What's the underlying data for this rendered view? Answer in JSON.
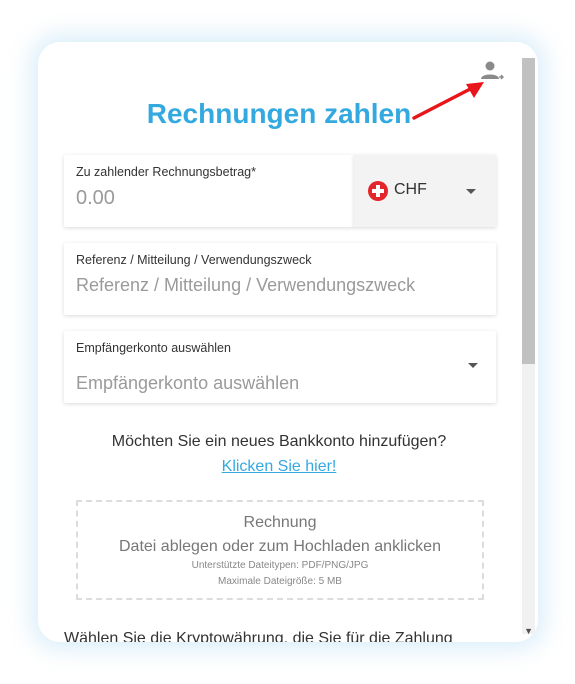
{
  "header": {
    "title": "Rechnungen zahlen"
  },
  "amount": {
    "label": "Zu zahlender Rechnungsbetrag*",
    "placeholder": "0.00",
    "currency": "CHF"
  },
  "reference": {
    "label": "Referenz / Mitteilung / Verwendungszweck",
    "placeholder": "Referenz / Mitteilung / Verwendungszweck"
  },
  "recipient": {
    "label": "Empfängerkonto auswählen",
    "placeholder": "Empfängerkonto auswählen"
  },
  "bank_prompt": {
    "question": "Möchten Sie ein neues Bankkonto hinzufügen?",
    "link": "Klicken Sie hier!"
  },
  "upload": {
    "title": "Rechnung",
    "instruction": "Datei ablegen oder zum Hochladen anklicken",
    "types": "Unterstützte Dateitypen: PDF/PNG/JPG",
    "max_size": "Maximale Dateigröße: 5 MB"
  },
  "crypto": {
    "text": "Wählen Sie die Kryptowährung, die Sie für die Zahlung"
  },
  "colors": {
    "accent": "#34a9e0",
    "arrow": "#e8161b",
    "flag": "#e3262c"
  },
  "icons": [
    "user-account-icon",
    "annotation-arrow",
    "swiss-flag-icon",
    "dropdown-caret-icon"
  ]
}
